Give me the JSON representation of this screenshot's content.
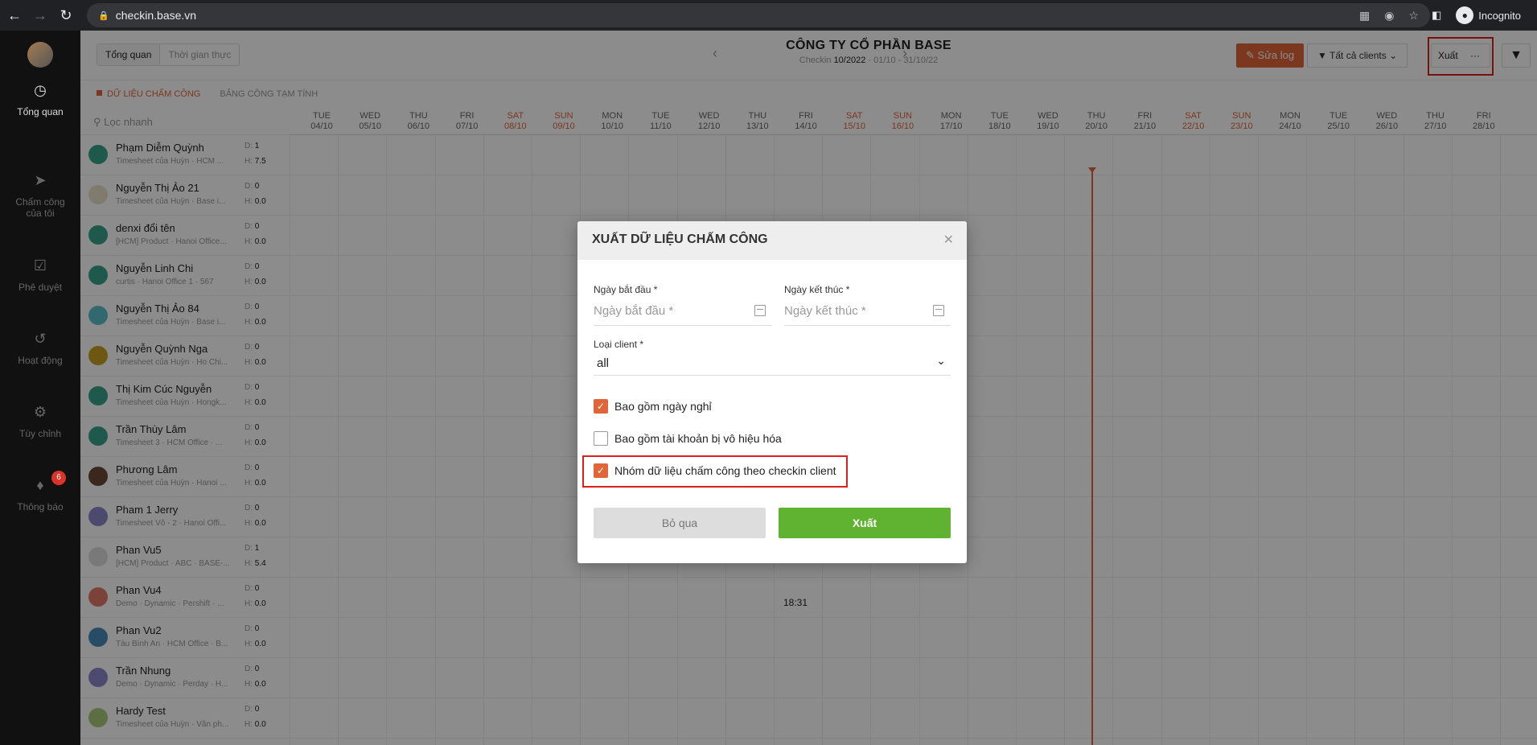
{
  "browser": {
    "url": "checkin.base.vn",
    "profile_label": "Incognito"
  },
  "sidebar": {
    "items": [
      {
        "label": "Tổng quan",
        "icon": "clock-icon",
        "active": true
      },
      {
        "label": "Chấm công của tôi",
        "icon": "location-icon",
        "active": false
      },
      {
        "label": "Phê duyệt",
        "icon": "check-square-icon",
        "active": false
      },
      {
        "label": "Hoạt động",
        "icon": "history-icon",
        "active": false
      },
      {
        "label": "Tùy chỉnh",
        "icon": "gear-icon",
        "active": false
      },
      {
        "label": "Thông báo",
        "icon": "bell-icon",
        "active": false,
        "badge": "6"
      }
    ]
  },
  "header": {
    "tab_overview": "Tổng quan",
    "tab_realtime": "Thời gian thực",
    "company": "CÔNG TY CỔ PHẦN BASE",
    "sub_prefix": "Checkin",
    "period": "10/2022",
    "range": "· 01/10 - 31/10/22",
    "btn_sualog": "Sửa log",
    "btn_clients": "Tất cả clients",
    "btn_xuat": "Xuất",
    "btn_more": "···"
  },
  "subtabs": {
    "data": "DỮ LIỆU CHẤM CÔNG",
    "table": "BẢNG CÔNG TẠM TÍNH"
  },
  "search": {
    "placeholder": "Lọc nhanh"
  },
  "days": [
    {
      "w": "TUE",
      "d": "04/10"
    },
    {
      "w": "WED",
      "d": "05/10"
    },
    {
      "w": "THU",
      "d": "06/10"
    },
    {
      "w": "FRI",
      "d": "07/10"
    },
    {
      "w": "SAT",
      "d": "08/10"
    },
    {
      "w": "SUN",
      "d": "09/10"
    },
    {
      "w": "MON",
      "d": "10/10"
    },
    {
      "w": "TUE",
      "d": "11/10"
    },
    {
      "w": "WED",
      "d": "12/10"
    },
    {
      "w": "THU",
      "d": "13/10"
    },
    {
      "w": "FRI",
      "d": "14/10"
    },
    {
      "w": "SAT",
      "d": "15/10"
    },
    {
      "w": "SUN",
      "d": "16/10"
    },
    {
      "w": "MON",
      "d": "17/10"
    },
    {
      "w": "TUE",
      "d": "18/10"
    },
    {
      "w": "WED",
      "d": "19/10"
    },
    {
      "w": "THU",
      "d": "20/10"
    },
    {
      "w": "FRI",
      "d": "21/10"
    },
    {
      "w": "SAT",
      "d": "22/10"
    },
    {
      "w": "SUN",
      "d": "23/10"
    },
    {
      "w": "MON",
      "d": "24/10"
    },
    {
      "w": "TUE",
      "d": "25/10"
    },
    {
      "w": "WED",
      "d": "26/10"
    },
    {
      "w": "THU",
      "d": "27/10"
    },
    {
      "w": "FRI",
      "d": "28/10"
    }
  ],
  "people": [
    {
      "name": "Phạm Diễm Quỳnh",
      "sub": "Timesheet của Huỳn · HCM ...",
      "d": "1",
      "h": "7.5",
      "color": "#3aa38a"
    },
    {
      "name": "Nguyễn Thị Ảo 21",
      "sub": "Timesheet của Huỳn · Base i...",
      "d": "0",
      "h": "0.0",
      "color": "#e8e0c8"
    },
    {
      "name": "denxi đổi tên",
      "sub": "[HCM] Product · Hanoi Office...",
      "d": "0",
      "h": "0.0",
      "color": "#3aa38a"
    },
    {
      "name": "Nguyễn Linh Chi",
      "sub": "curtis · Hanoi Office 1 · 567",
      "d": "0",
      "h": "0.0",
      "color": "#3aa38a"
    },
    {
      "name": "Nguyễn Thị Ảo 84",
      "sub": "Timesheet của Huỳn · Base i...",
      "d": "0",
      "h": "0.0",
      "color": "#5bc0c8"
    },
    {
      "name": "Nguyễn Quỳnh Nga",
      "sub": "Timesheet của Huỳn · Ho Chi...",
      "d": "0",
      "h": "0.0",
      "color": "#c8a020"
    },
    {
      "name": "Thị Kim Cúc Nguyễn",
      "sub": "Timesheet của Huỳn · Hongk...",
      "d": "0",
      "h": "0.0",
      "color": "#3aa38a"
    },
    {
      "name": "Trần Thùy Lâm",
      "sub": "Timesheet 3 · HCM Office · ...",
      "d": "0",
      "h": "0.0",
      "color": "#3aa38a"
    },
    {
      "name": "Phương Lâm",
      "sub": "Timesheet của Huỳn · Hanoi ...",
      "d": "0",
      "h": "0.0",
      "color": "#6a4a3a"
    },
    {
      "name": "Pham 1 Jerry",
      "sub": "Timesheet Vô - 2 · Hanoi Offi...",
      "d": "0",
      "h": "0.0",
      "color": "#8a88c8"
    },
    {
      "name": "Phan Vu5",
      "sub": "[HCM] Product · ABC · BASE-...",
      "d": "1",
      "h": "5.4",
      "color": "#ddd"
    },
    {
      "name": "Phan Vu4",
      "sub": "Demo · Dynamic · Pershift · ...",
      "d": "0",
      "h": "0.0",
      "color": "#e07868"
    },
    {
      "name": "Phan Vu2",
      "sub": "Tàu Bình An · HCM Office · B...",
      "d": "0",
      "h": "0.0",
      "color": "#4a8ab8"
    },
    {
      "name": "Trần Nhung",
      "sub": "Demo · Dynamic · Perday · H...",
      "d": "0",
      "h": "0.0",
      "color": "#8a88c8"
    },
    {
      "name": "Hardy Test",
      "sub": "Timesheet của Huỳn · Văn ph...",
      "d": "0",
      "h": "0.0",
      "color": "#a8c878"
    }
  ],
  "grid_note": "18:31",
  "modal": {
    "title": "XUẤT DỮ LIỆU CHẤM CÔNG",
    "start_label": "Ngày bắt đầu *",
    "start_placeholder": "Ngày bắt đầu *",
    "end_label": "Ngày kết thúc *",
    "end_placeholder": "Ngày kết thúc *",
    "client_label": "Loại client *",
    "client_value": "all",
    "chk1": {
      "label": "Bao gồm ngày nghỉ",
      "checked": true
    },
    "chk2": {
      "label": "Bao gồm tài khoản bị vô hiệu hóa",
      "checked": false
    },
    "chk3": {
      "label": "Nhóm dữ liệu chấm công theo checkin client",
      "checked": true
    },
    "cancel": "Bỏ qua",
    "export": "Xuất"
  }
}
